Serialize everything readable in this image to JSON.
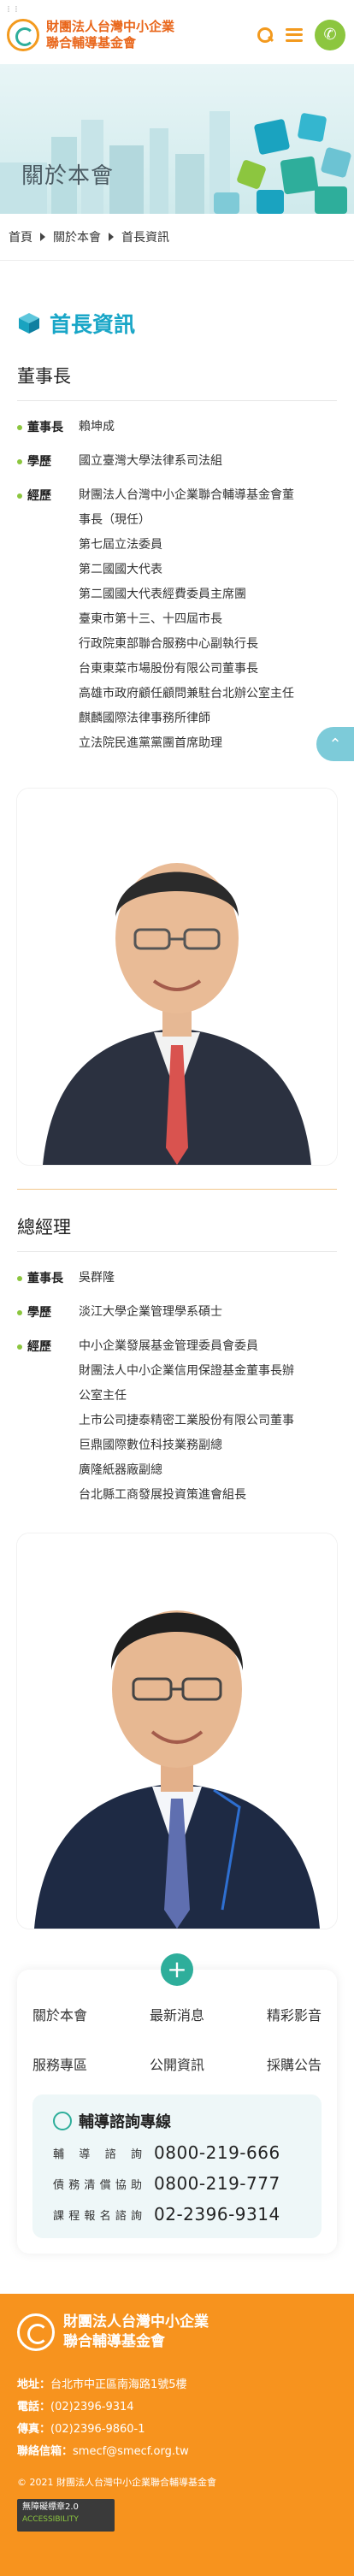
{
  "header": {
    "org_line1": "財團法人台灣中小企業",
    "org_line2": "聯合輔導基金會",
    "search_icon": "search-icon",
    "menu_icon": "menu-icon",
    "phone_icon": "phone-icon"
  },
  "banner": {
    "title": "關於本會"
  },
  "breadcrumb": [
    "首頁",
    "關於本會",
    "首長資訊"
  ],
  "section_title": "首長資訊",
  "chairman": {
    "role": "董事長",
    "rows": [
      {
        "label": "董事長",
        "value": [
          "賴坤成"
        ]
      },
      {
        "label": "學歷",
        "value": [
          "國立臺灣大學法律系司法組"
        ]
      },
      {
        "label": "經歷",
        "value": [
          "財團法人台灣中小企業聯合輔導基金會董",
          "事長（現任）",
          "第七屆立法委員",
          "第二國國大代表",
          "第二國國大代表經費委員主席團",
          "臺東市第十三、十四屆市長",
          "行政院東部聯合服務中心副執行長",
          "台東東菜市場股份有限公司董事長",
          "高雄市政府顧任顧問兼駐台北辦公室主任",
          "麒麟國際法律事務所律師",
          "立法院民進黨黨團首席助理"
        ]
      }
    ]
  },
  "manager": {
    "role": "總經理",
    "rows": [
      {
        "label": "董事長",
        "value": [
          "吳群隆"
        ]
      },
      {
        "label": "學歷",
        "value": [
          "淡江大學企業管理學系碩士"
        ]
      },
      {
        "label": "經歷",
        "value": [
          "中小企業發展基金管理委員會委員",
          "財團法人中小企業信用保證基金董事長辦",
          "公室主任",
          "上市公司捷泰精密工業股份有限公司董事",
          "巨鼎國際數位科技業務副總",
          "廣隆紙器廠副總",
          "台北縣工商發展投資策進會組長"
        ]
      }
    ]
  },
  "footer_links": [
    "關於本會",
    "最新消息",
    "精彩影音",
    "服務專區",
    "公開資訊",
    "採購公告"
  ],
  "hotline": {
    "title": "輔導諮詢專線",
    "rows": [
      {
        "label": "輔導諮詢",
        "number": "0800-219-666"
      },
      {
        "label": "債務清償協助",
        "number": "0800-219-777"
      },
      {
        "label": "課程報名諮詢",
        "number": "02-2396-9314"
      }
    ]
  },
  "footer": {
    "name_line1": "財團法人台灣中小企業",
    "name_line2": "聯合輔導基金會",
    "address_label": "地址：",
    "address": "台北市中正區南海路1號5樓",
    "phone_label": "電話：",
    "phone": "(02)2396-9314",
    "fax_label": "傳真：",
    "fax": "(02)2396-9860-1",
    "email_label": "聯絡信箱：",
    "email": "smecf@smecf.org.tw",
    "copyright": "© 2021 財團法人台灣中小企業聯合輔導基金會",
    "badge_line1": "無障礙標章2.0",
    "badge_line2": "ACCESSIBILITY"
  },
  "colors": {
    "orange": "#f7931e",
    "teal": "#19a6c7",
    "green": "#8cc63f"
  }
}
